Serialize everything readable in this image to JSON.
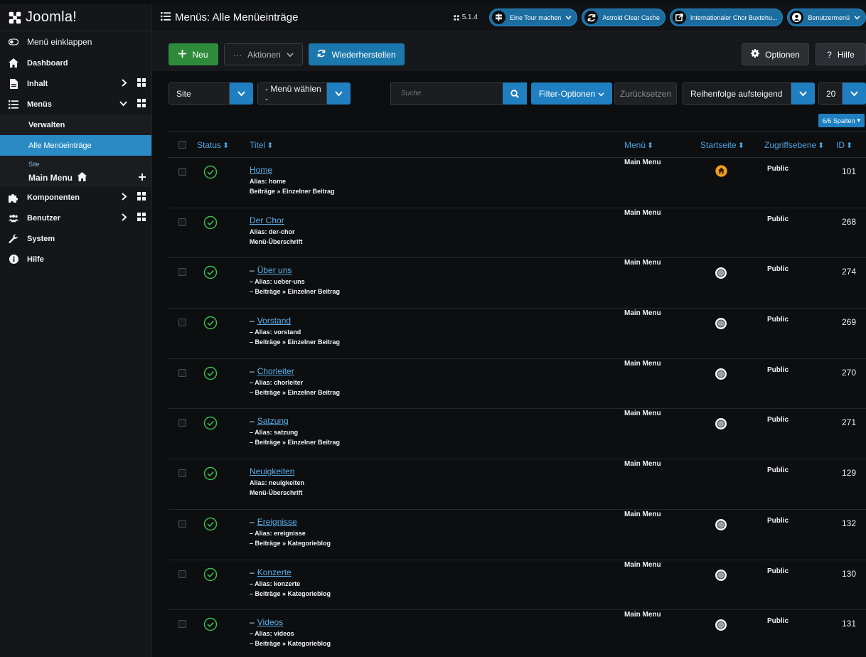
{
  "brand": {
    "name": "Joomla!"
  },
  "header": {
    "title": "Menüs: Alle Menüeinträge",
    "version": "5.1.4"
  },
  "top_buttons": {
    "tour": "Eine Tour machen",
    "cache": "Astroid Clear Cache",
    "site": "Internationaler Chor Buxtehu...",
    "user": "Benutzermenü"
  },
  "sidebar": {
    "collapse": "Menü einklappen",
    "items": [
      {
        "label": "Dashboard"
      },
      {
        "label": "Inhalt"
      },
      {
        "label": "Menüs"
      },
      {
        "label": "Komponenten"
      },
      {
        "label": "Benutzer"
      },
      {
        "label": "System"
      },
      {
        "label": "Hilfe"
      }
    ],
    "menus_sub": {
      "manage": "Verwalten",
      "all_items": "Alle Menüeinträge",
      "site_label": "Site",
      "main_menu": "Main Menu"
    }
  },
  "toolbar": {
    "new": "Neu",
    "actions": "Aktionen",
    "rebuild": "Wiederherstellen",
    "options": "Optionen",
    "help": "Hilfe"
  },
  "filters": {
    "client": "Site",
    "menu_select": "- Menü wählen -",
    "search_placeholder": "Suche",
    "filter_options": "Filter-Optionen",
    "reset": "Zurücksetzen",
    "ordering": "Reihenfolge aufsteigend",
    "limit": "20",
    "columns": "6/6 Spalten"
  },
  "table": {
    "headers": {
      "status": "Status",
      "title": "Titel",
      "menu": "Menü",
      "home": "Startseite",
      "access": "Zugriffsebene",
      "id": "ID"
    },
    "rows": [
      {
        "title": "Home",
        "alias": "Alias: home",
        "type": "Beiträge » Einzelner Beitrag",
        "menu": "Main Menu",
        "home": "home",
        "access": "Public",
        "id": "101",
        "child": false
      },
      {
        "title": "Der Chor",
        "alias": "Alias: der-chor",
        "type": "Menü-Überschrift",
        "menu": "Main Menu",
        "home": "none",
        "access": "Public",
        "id": "268",
        "child": false
      },
      {
        "title": "Über uns",
        "alias": "Alias: ueber-uns",
        "type": "Beiträge » Einzelner Beitrag",
        "menu": "Main Menu",
        "home": "dot",
        "access": "Public",
        "id": "274",
        "child": true
      },
      {
        "title": "Vorstand",
        "alias": "Alias: vorstand",
        "type": "Beiträge » Einzelner Beitrag",
        "menu": "Main Menu",
        "home": "dot",
        "access": "Public",
        "id": "269",
        "child": true
      },
      {
        "title": "Chorleiter",
        "alias": "Alias: chorleiter",
        "type": "Beiträge » Einzelner Beitrag",
        "menu": "Main Menu",
        "home": "dot",
        "access": "Public",
        "id": "270",
        "child": true
      },
      {
        "title": "Satzung",
        "alias": "Alias: satzung",
        "type": "Beiträge » Einzelner Beitrag",
        "menu": "Main Menu",
        "home": "dot",
        "access": "Public",
        "id": "271",
        "child": true
      },
      {
        "title": "Neuigkeiten",
        "alias": "Alias: neuigkeiten",
        "type": "Menü-Überschrift",
        "menu": "Main Menu",
        "home": "none",
        "access": "Public",
        "id": "129",
        "child": false
      },
      {
        "title": "Ereignisse",
        "alias": "Alias: ereignisse",
        "type": "Beiträge » Kategorieblog",
        "menu": "Main Menu",
        "home": "dot",
        "access": "Public",
        "id": "132",
        "child": true
      },
      {
        "title": "Konzerte",
        "alias": "Alias: konzerte",
        "type": "Beiträge » Kategorieblog",
        "menu": "Main Menu",
        "home": "dot",
        "access": "Public",
        "id": "130",
        "child": true
      },
      {
        "title": "Videos",
        "alias": "Alias: videos",
        "type": "Beiträge » Kategorieblog",
        "menu": "Main Menu",
        "home": "dot",
        "access": "Public",
        "id": "131",
        "child": true
      }
    ]
  },
  "colors": {
    "accent": "#1f7fc0",
    "success": "#2f8b3c",
    "link": "#5ab0ea",
    "home_icon": "#f0a020",
    "status_ok": "#3fb950"
  },
  "icons": {
    "sidebar": [
      "toggle-icon",
      "home-icon",
      "file-icon",
      "list-icon",
      "puzzle-icon",
      "users-icon",
      "wrench-icon",
      "info-icon"
    ],
    "row_status": "check-circle-icon",
    "row_home": "home-circle-icon",
    "row_default": "radio-dot-icon"
  }
}
